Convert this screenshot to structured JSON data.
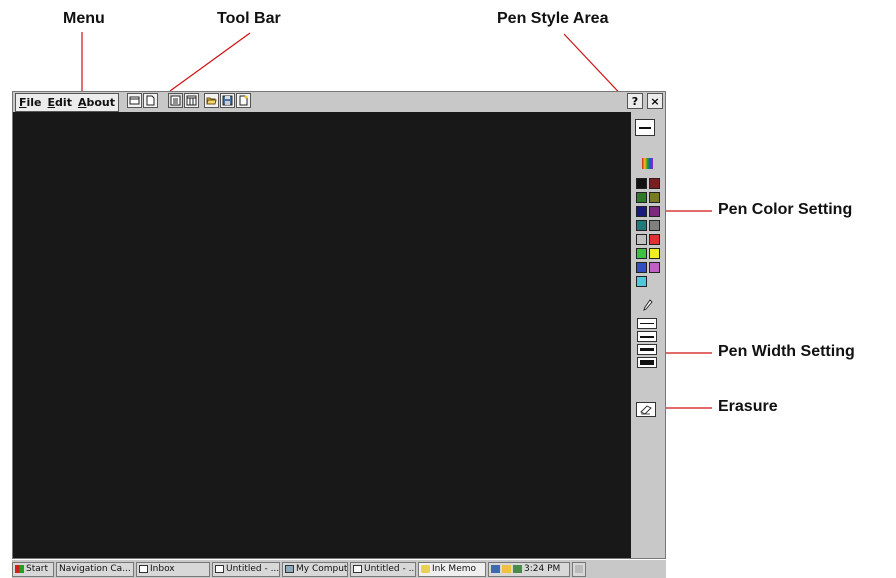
{
  "callouts": {
    "menu": "Menu",
    "toolbar": "Tool Bar",
    "pen_style": "Pen Style Area",
    "pen_color": "Pen Color Setting",
    "pen_width": "Pen Width Setting",
    "erasure": "Erasure"
  },
  "menu": {
    "file": "File",
    "edit": "Edit",
    "about": "About"
  },
  "toolbar": {
    "icons": [
      "new-window-icon",
      "new-page-icon",
      "list-view-icon",
      "grid-view-icon",
      "open-folder-icon",
      "save-disk-icon",
      "new-document-icon"
    ]
  },
  "window_buttons": {
    "help": "?",
    "close": "×"
  },
  "palette": {
    "colors": [
      "#111111",
      "#7a1f1f",
      "#2d7a2d",
      "#7a7a23",
      "#1a1a7a",
      "#7a2a7a",
      "#1f7a7a",
      "#808080",
      "#c0c0c0",
      "#e03030",
      "#40c040",
      "#f0f020",
      "#3050c0",
      "#c060c0",
      "#50c8d8"
    ]
  },
  "taskbar": {
    "start": "Start",
    "items": [
      "Navigation Ca...",
      "Inbox",
      "Untitled - ...",
      "My Computer",
      "Untitled - ...",
      "Ink Memo"
    ],
    "clock": "3:24 PM"
  }
}
